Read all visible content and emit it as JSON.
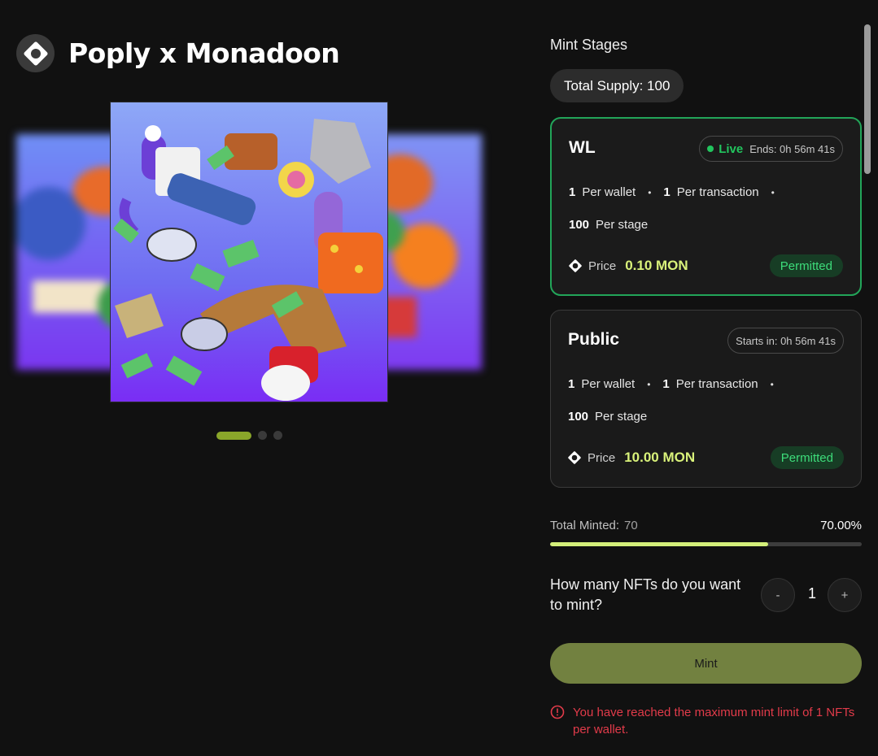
{
  "collection": {
    "title": "Poply x Monadoon",
    "logo_icon": "poply-ring-icon"
  },
  "carousel": {
    "slide_count": 3,
    "active_index": 0,
    "accent_color": "#8aa62a"
  },
  "mint_stages": {
    "heading": "Mint Stages",
    "total_supply_label": "Total Supply: 100",
    "stages": [
      {
        "name": "WL",
        "status": "Live",
        "timer": "Ends: 0h 56m 41s",
        "per_wallet_value": "1",
        "per_wallet_label": "Per wallet",
        "per_tx_value": "1",
        "per_tx_label": "Per transaction",
        "per_stage_value": "100",
        "per_stage_label": "Per stage",
        "price_label": "Price",
        "price_value": "0.10 MON",
        "permission": "Permitted"
      },
      {
        "name": "Public",
        "timer": "Starts in: 0h 56m 41s",
        "per_wallet_value": "1",
        "per_wallet_label": "Per wallet",
        "per_tx_value": "1",
        "per_tx_label": "Per transaction",
        "per_stage_value": "100",
        "per_stage_label": "Per stage",
        "price_label": "Price",
        "price_value": "10.00 MON",
        "permission": "Permitted"
      }
    ]
  },
  "progress": {
    "label": "Total Minted:",
    "minted": "70",
    "percent_label": "70.00%",
    "fraction": 0.7,
    "bar_color": "#d4ef7a"
  },
  "quantity": {
    "question": "How many NFTs do you want to mint?",
    "decrement_label": "-",
    "value": "1",
    "increment_label": "+"
  },
  "mint_button": {
    "label": "Mint",
    "color": "#728140"
  },
  "error": {
    "icon": "alert-circle-icon",
    "message": "You have reached the maximum mint limit of 1 NFTs per wallet.",
    "color": "#e23b4a"
  },
  "colors": {
    "background": "#111111",
    "live_green": "#22c55e",
    "price_accent": "#d9f27a"
  }
}
